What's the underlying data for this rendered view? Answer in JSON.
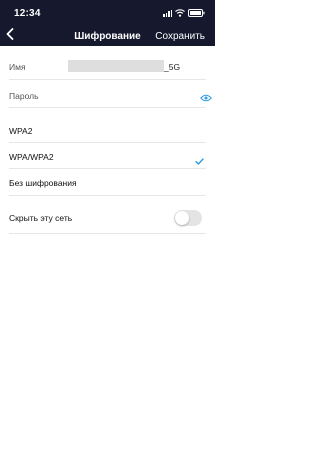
{
  "status_bar": {
    "time": "12:34"
  },
  "header": {
    "title": "Шифрование",
    "save_label": "Сохранить",
    "back_icon": "chevron-left-icon"
  },
  "fields": {
    "name": {
      "label": "Имя",
      "value_suffix": "_5G"
    },
    "password": {
      "label": "Пароль",
      "icon": "eye-icon"
    }
  },
  "encryption_options": [
    {
      "label": "WPA2",
      "selected": false
    },
    {
      "label": "WPA/WPA2",
      "selected": true
    },
    {
      "label": "Без шифрования",
      "selected": false
    }
  ],
  "hide_network": {
    "label": "Скрыть эту сеть",
    "enabled": false
  },
  "colors": {
    "header_bg": "#16192e",
    "accent": "#2f9be0",
    "toggle_off": "#e4e4e4"
  }
}
